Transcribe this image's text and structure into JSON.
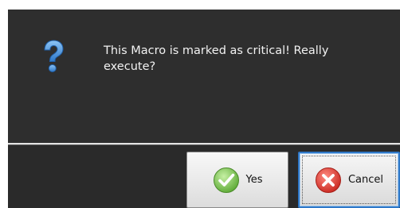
{
  "dialog": {
    "message": "This Macro is marked as critical! Really execute?",
    "icon": "question-icon",
    "buttons": {
      "yes_label": "Yes",
      "yes_icon": "checkmark-icon",
      "cancel_label": "Cancel",
      "cancel_icon": "cancel-x-icon",
      "focused": "cancel"
    }
  },
  "colors": {
    "background": "#2b2b2b",
    "text": "#f2f2f2",
    "question_icon": "#4a90d9",
    "yes_icon": "#6cc24a",
    "cancel_icon": "#d9342b",
    "focus_border": "#2f78c8"
  }
}
